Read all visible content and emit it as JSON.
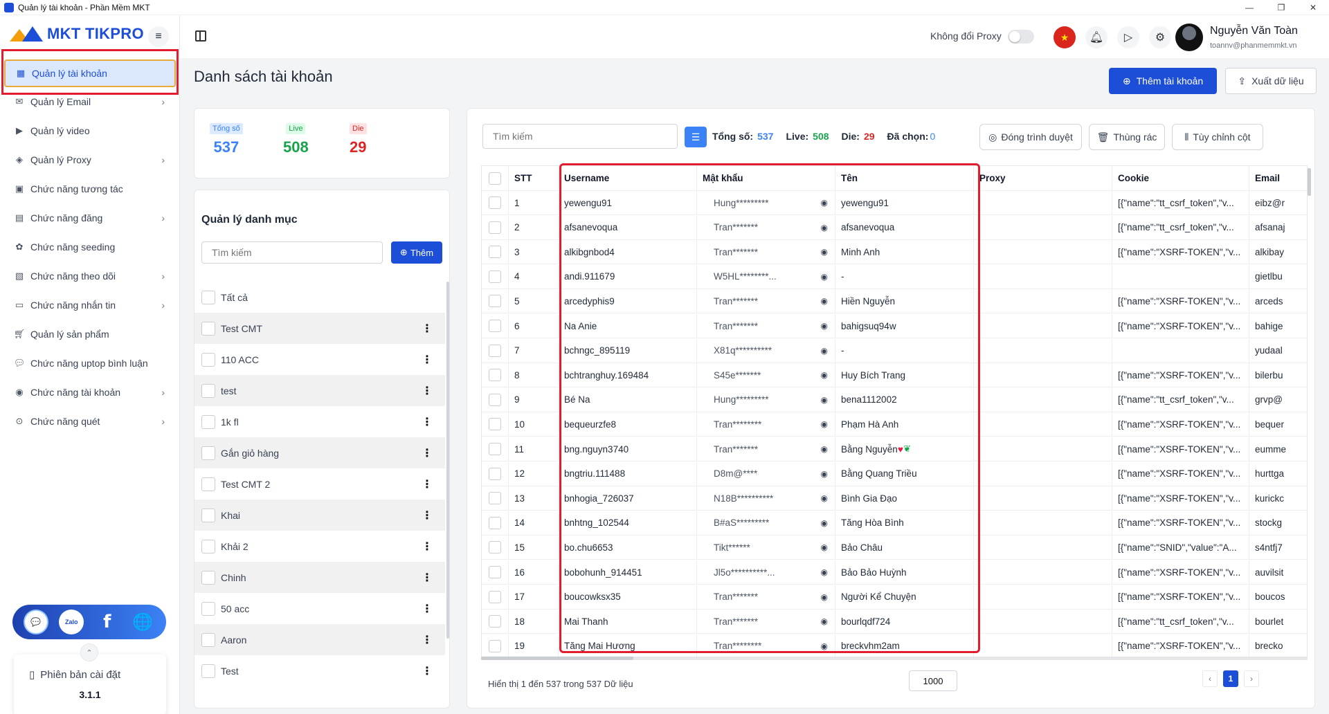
{
  "window": {
    "title": "Quản lý tài khoản - Phần Mềm MKT",
    "minimize": "—",
    "maximize": "❐",
    "close": "✕"
  },
  "logo": {
    "text": "MKT TIKPRO"
  },
  "sidebar": {
    "items": [
      {
        "label": "Quản lý tài khoản",
        "icon": "grid-icon",
        "chevron": false,
        "active": true
      },
      {
        "label": "Quản lý Email",
        "icon": "mail-icon",
        "chevron": true
      },
      {
        "label": "Quản lý video",
        "icon": "video-icon",
        "chevron": false
      },
      {
        "label": "Quản lý Proxy",
        "icon": "proxy-icon",
        "chevron": true
      },
      {
        "label": "Chức năng tương tác",
        "icon": "interaction-icon",
        "chevron": false
      },
      {
        "label": "Chức năng đăng",
        "icon": "post-icon",
        "chevron": true
      },
      {
        "label": "Chức năng seeding",
        "icon": "seeding-icon",
        "chevron": false
      },
      {
        "label": "Chức năng theo dõi",
        "icon": "follow-icon",
        "chevron": true
      },
      {
        "label": "Chức năng nhắn tin",
        "icon": "message-icon",
        "chevron": true
      },
      {
        "label": "Quản lý sản phẩm",
        "icon": "cart-icon",
        "chevron": false
      },
      {
        "label": "Chức năng uptop bình luận",
        "icon": "comment-icon",
        "chevron": false
      },
      {
        "label": "Chức năng tài khoản",
        "icon": "user-icon",
        "chevron": true
      },
      {
        "label": "Chức năng quét",
        "icon": "scan-icon",
        "chevron": true
      }
    ],
    "social": {
      "zalo": "Zalo",
      "facebook": "f"
    },
    "version_label": "Phiên bản cài đặt",
    "version": "3.1.1"
  },
  "topbar": {
    "proxy_label": "Không đổi Proxy",
    "user_name": "Nguyễn Văn Toàn",
    "user_email": "toannv@phanmemmkt.vn"
  },
  "page": {
    "title": "Danh sách tài khoản",
    "add_button": "Thêm tài khoản",
    "export_button": "Xuất dữ liệu"
  },
  "stats": {
    "total_label": "Tổng số",
    "total": "537",
    "live_label": "Live",
    "live": "508",
    "die_label": "Die",
    "die": "29"
  },
  "categories": {
    "title": "Quản lý danh mục",
    "search_placeholder": "Tìm kiếm",
    "add_button": "Thêm",
    "items": [
      "Tất cả",
      "Test CMT",
      "110 ACC",
      "test",
      "1k fl",
      "Gắn giỏ hàng",
      "Test CMT 2",
      "Khai",
      "Khải 2",
      "Chinh",
      "50 acc",
      "Aaron",
      "Test"
    ]
  },
  "table": {
    "search_placeholder": "Tìm kiếm",
    "total_label": "Tổng số:",
    "total": "537",
    "live_label": "Live:",
    "live": "508",
    "die_label": "Die:",
    "die": "29",
    "selected_label": "Đã chọn:",
    "selected": "0",
    "close_browser": "Đóng trình duyệt",
    "trash": "Thùng rác",
    "customize_columns": "Tùy chỉnh cột",
    "columns": [
      "STT",
      "Username",
      "Mật khẩu",
      "Tên",
      "Proxy",
      "Cookie",
      "Email"
    ],
    "rows": [
      {
        "stt": "1",
        "username": "yewengu91",
        "password": "Hung*********",
        "name": "yewengu91",
        "proxy": "",
        "cookie": "[{\"name\":\"tt_csrf_token\",\"v...",
        "email": "eibz@r"
      },
      {
        "stt": "2",
        "username": "afsanevoqua",
        "password": "Tran*******",
        "name": "afsanevoqua",
        "proxy": "",
        "cookie": "[{\"name\":\"tt_csrf_token\",\"v...",
        "email": "afsanaj"
      },
      {
        "stt": "3",
        "username": "alkibgnbod4",
        "password": "Tran*******",
        "name": "Minh Anh",
        "proxy": "",
        "cookie": "[{\"name\":\"XSRF-TOKEN\",\"v...",
        "email": "alkibay"
      },
      {
        "stt": "4",
        "username": "andi.911679",
        "password": "W5HL********...",
        "name": "-",
        "proxy": "",
        "cookie": "",
        "email": "gietlbu"
      },
      {
        "stt": "5",
        "username": "arcedyphis9",
        "password": "Tran*******",
        "name": "Hiền Nguyễn",
        "proxy": "",
        "cookie": "[{\"name\":\"XSRF-TOKEN\",\"v...",
        "email": "arceds"
      },
      {
        "stt": "6",
        "username": "Na Anie",
        "password": "Tran*******",
        "name": "bahigsuq94w",
        "proxy": "",
        "cookie": "[{\"name\":\"XSRF-TOKEN\",\"v...",
        "email": "bahige"
      },
      {
        "stt": "7",
        "username": "bchngc_895119",
        "password": "X81q**********",
        "name": "-",
        "proxy": "",
        "cookie": "",
        "email": "yudaal"
      },
      {
        "stt": "8",
        "username": "bchtranghuy.169484",
        "password": "S45e*******",
        "name": "Huy Bích Trang",
        "proxy": "",
        "cookie": "[{\"name\":\"XSRF-TOKEN\",\"v...",
        "email": "bilerbu"
      },
      {
        "stt": "9",
        "username": "Bé Na",
        "password": "Hung*********",
        "name": "bena1112002",
        "proxy": "",
        "cookie": "[{\"name\":\"tt_csrf_token\",\"v...",
        "email": "grvp@"
      },
      {
        "stt": "10",
        "username": "bequeurzfe8",
        "password": "Tran********",
        "name": "Phạm Hà Anh",
        "proxy": "",
        "cookie": "[{\"name\":\"XSRF-TOKEN\",\"v...",
        "email": "bequer"
      },
      {
        "stt": "11",
        "username": "bng.nguyn3740",
        "password": "Tran*******",
        "name": "Bằng Nguyễn",
        "proxy": "",
        "cookie": "[{\"name\":\"XSRF-TOKEN\",\"v...",
        "email": "eumme",
        "emoji": true
      },
      {
        "stt": "12",
        "username": "bngtriu.111488",
        "password": "D8m@****",
        "name": "Bằng Quang Triều",
        "proxy": "",
        "cookie": "[{\"name\":\"XSRF-TOKEN\",\"v...",
        "email": "hurttga"
      },
      {
        "stt": "13",
        "username": "bnhogia_726037",
        "password": "N18B**********",
        "name": "Bình Gia Đạo",
        "proxy": "",
        "cookie": "[{\"name\":\"XSRF-TOKEN\",\"v...",
        "email": "kurickc"
      },
      {
        "stt": "14",
        "username": "bnhtng_102544",
        "password": "B#aS*********",
        "name": "Tăng Hòa Bình",
        "proxy": "",
        "cookie": "[{\"name\":\"XSRF-TOKEN\",\"v...",
        "email": "stockg"
      },
      {
        "stt": "15",
        "username": "bo.chu6653",
        "password": "Tikt******",
        "name": "Bảo Châu",
        "proxy": "",
        "cookie": "[{\"name\":\"SNID\",\"value\":\"A...",
        "email": "s4ntfj7"
      },
      {
        "stt": "16",
        "username": "bobohunh_914451",
        "password": "Jl5o**********...",
        "name": "Bảo Bảo Huỳnh",
        "proxy": "",
        "cookie": "[{\"name\":\"XSRF-TOKEN\",\"v...",
        "email": "auvilsit"
      },
      {
        "stt": "17",
        "username": "boucowksx35",
        "password": "Tran*******",
        "name": "Người Kể Chuyện",
        "proxy": "",
        "cookie": "[{\"name\":\"XSRF-TOKEN\",\"v...",
        "email": "boucos"
      },
      {
        "stt": "18",
        "username": "Mai Thanh",
        "password": "Tran*******",
        "name": "bourlqdf724",
        "proxy": "",
        "cookie": "[{\"name\":\"tt_csrf_token\",\"v...",
        "email": "bourlet"
      },
      {
        "stt": "19",
        "username": "Tăng Mai Hương",
        "password": "Tran********",
        "name": "breckvhm2am",
        "proxy": "",
        "cookie": "[{\"name\":\"XSRF-TOKEN\",\"v...",
        "email": "brecko"
      }
    ],
    "footer": "Hiển thị 1 đến 537 trong 537 Dữ liệu",
    "page_size": "1000",
    "current_page": "1"
  },
  "colors": {
    "primary": "#1d4ed8",
    "live": "#16a34a",
    "die": "#dc2626",
    "highlight": "#e11d2e"
  }
}
